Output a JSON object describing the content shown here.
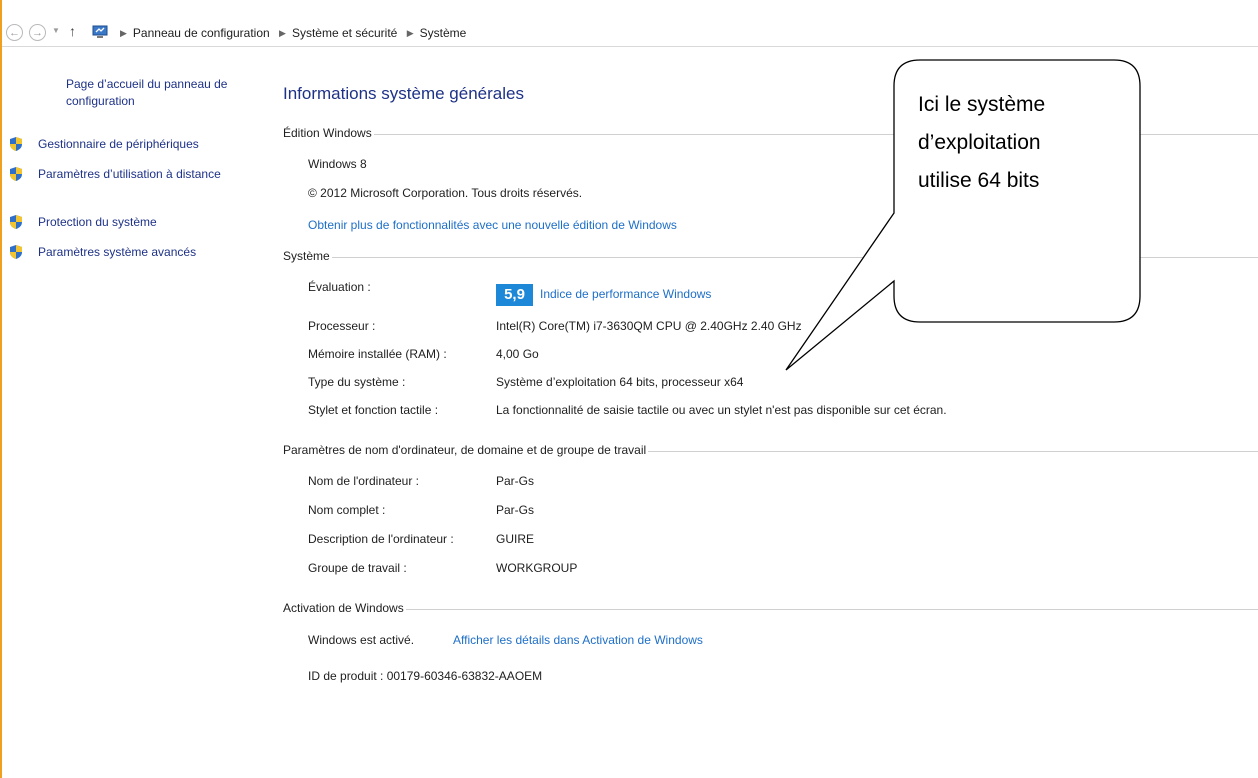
{
  "addressbar": {
    "crumbs": [
      "Panneau de configuration",
      "Système et sécurité",
      "Système"
    ]
  },
  "sidebar": {
    "home": "Page d’accueil du panneau de configuration",
    "items": [
      {
        "label": "Gestionnaire de périphériques"
      },
      {
        "label": "Paramètres d’utilisation à distance"
      },
      {
        "label": "Protection du système"
      },
      {
        "label": "Paramètres système avancés"
      }
    ]
  },
  "main": {
    "title": "Informations système générales",
    "edition": {
      "heading": "Édition Windows",
      "name": "Windows 8",
      "copyright": "© 2012 Microsoft Corporation. Tous droits réservés.",
      "upgrade_link": "Obtenir plus de fonctionnalités avec une nouvelle édition de Windows"
    },
    "system": {
      "heading": "Système",
      "rating_label": "Évaluation :",
      "rating_score": "5,9",
      "rating_link": "Indice de performance Windows",
      "rows": [
        {
          "label": "Processeur :",
          "value": "Intel(R) Core(TM) i7-3630QM CPU @ 2.40GHz   2.40 GHz"
        },
        {
          "label": "Mémoire installée (RAM) :",
          "value": "4,00 Go"
        },
        {
          "label": "Type du système :",
          "value": "Système d’exploitation 64 bits, processeur x64"
        },
        {
          "label": "Stylet et fonction tactile :",
          "value": "La fonctionnalité de saisie tactile ou avec un stylet n'est pas disponible sur cet écran."
        }
      ]
    },
    "computer": {
      "heading": "Paramètres de nom d'ordinateur, de domaine et de groupe de travail",
      "rows": [
        {
          "label": "Nom de l'ordinateur :",
          "value": "Par-Gs"
        },
        {
          "label": "Nom complet :",
          "value": "Par-Gs"
        },
        {
          "label": "Description de l'ordinateur :",
          "value": "GUIRE"
        },
        {
          "label": "Groupe de travail :",
          "value": "WORKGROUP"
        }
      ]
    },
    "activation": {
      "heading": "Activation de Windows",
      "status": "Windows est activé.",
      "details_link": "Afficher les détails dans Activation de Windows",
      "product_id": "ID de produit : 00179-60346-63832-AAOEM"
    }
  },
  "callout": {
    "lines": [
      "Ici le système",
      "d’exploitation",
      "utilise 64 bits"
    ]
  },
  "colors": {
    "link": "#1e6fc8",
    "heading_link": "#1e3287",
    "badge": "#1e88d8",
    "frame": "#f0a020"
  }
}
